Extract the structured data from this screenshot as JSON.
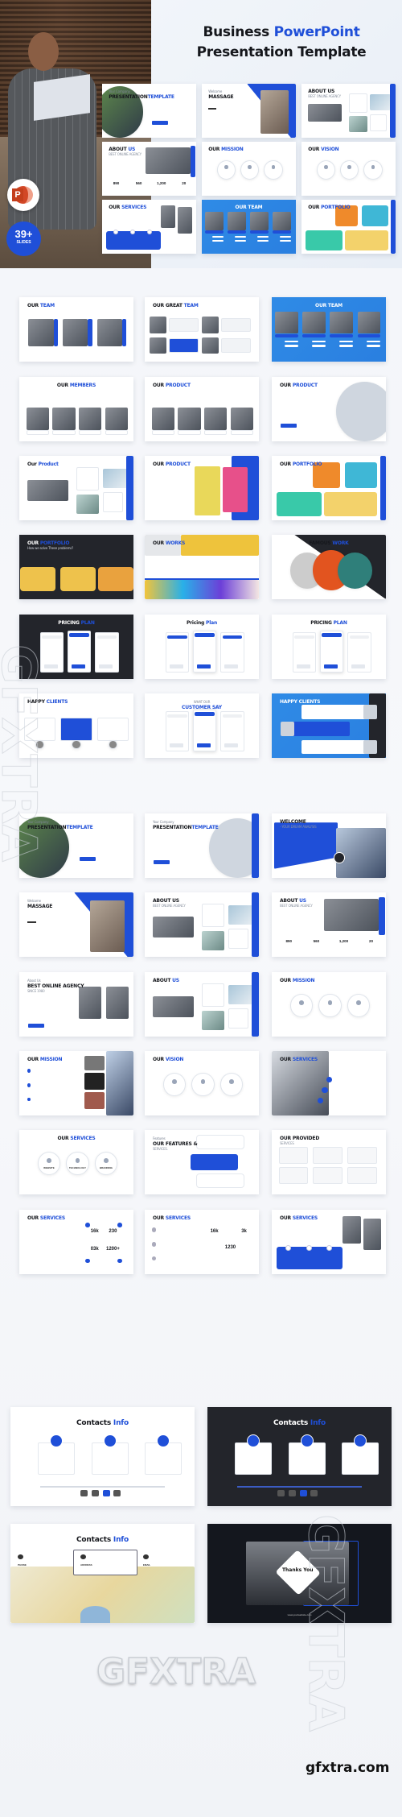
{
  "hero": {
    "title_dark_1": "Business ",
    "title_blue": "PowerPoint",
    "title_line2": "Presentation Template",
    "badge_count": "39+",
    "badge_label": "SLIDES",
    "powerpoint_icon": "powerpoint-logo-icon",
    "powerpoint_letter": "P"
  },
  "colors": {
    "accent": "#1f4fd8",
    "dark": "#23252b",
    "sky": "#2f8be6"
  },
  "hero_slides": [
    {
      "pre": "Your Company",
      "t1": "PRESENTATION",
      "t2": "TEMPLATE",
      "theme": "light",
      "deco": "circle-photo-left"
    },
    {
      "pre": "Welcome",
      "t1": "MASSAGE",
      "t2": "",
      "theme": "light",
      "deco": "photo-right"
    },
    {
      "t1": "ABOUT US",
      "t2": "",
      "sub": "BEST ONLINE AGENCY",
      "theme": "light",
      "deco": "collage"
    },
    {
      "t1": "ABOUT ",
      "t2": "US",
      "sub": "BEST ONLINE AGENCY",
      "theme": "light",
      "deco": "stats-photo",
      "stats": [
        "890",
        "560",
        "1,200",
        "20"
      ]
    },
    {
      "t1": "OUR ",
      "t2": "MISSION",
      "theme": "light",
      "deco": "circles"
    },
    {
      "t1": "OUR ",
      "t2": "VISION",
      "theme": "light",
      "deco": "circles"
    },
    {
      "t1": "OUR ",
      "t2": "SERVICES",
      "theme": "light",
      "deco": "blue-band"
    },
    {
      "t1": "",
      "t2": "OUR TEAM",
      "theme": "blue",
      "align": "center",
      "deco": "team"
    },
    {
      "t1": "OUR ",
      "t2": "PORTFOLIO",
      "theme": "light",
      "deco": "portfolio"
    }
  ],
  "section1": [
    {
      "t1": "OUR ",
      "t2": "TEAM",
      "theme": "light",
      "deco": "photos3"
    },
    {
      "t1": "OUR GREAT ",
      "t2": "TEAM",
      "theme": "light",
      "deco": "grid4"
    },
    {
      "t1": "",
      "t2": "OUR TEAM",
      "theme": "blue",
      "align": "center",
      "deco": "team"
    },
    {
      "t1": "OUR ",
      "t2": "MEMBERS",
      "theme": "light",
      "align": "center",
      "deco": "photos4"
    },
    {
      "t1": "OUR ",
      "t2": "PRODUCT",
      "theme": "light",
      "deco": "photos4"
    },
    {
      "t1": "OUR ",
      "t2": "PRODUCT",
      "theme": "light",
      "deco": "circle-right"
    },
    {
      "t1": "Our ",
      "t2": "Product",
      "theme": "light",
      "deco": "collage"
    },
    {
      "t1": "OUR ",
      "t2": "PRODUCT",
      "theme": "light",
      "deco": "color-panels"
    },
    {
      "t1": "OUR ",
      "t2": "PORTFOLIO",
      "theme": "light",
      "deco": "portfolio"
    },
    {
      "t1": "OUR ",
      "t2": "PORTFOLIO",
      "sub": "How we solve These problems?",
      "theme": "dark",
      "deco": "yellow-row"
    },
    {
      "t1": "OUR ",
      "t2": "WORKS",
      "theme": "light",
      "deco": "works"
    },
    {
      "t1": "FAMOUS ",
      "t2": "WORK",
      "theme": "light",
      "align": "center",
      "deco": "famous"
    },
    {
      "t1": "PRICING ",
      "t2": "PLAN",
      "theme": "dark",
      "align": "center",
      "deco": "pricing"
    },
    {
      "t1": "Pricing ",
      "t2": "Plan",
      "theme": "light",
      "align": "center",
      "deco": "pricing"
    },
    {
      "t1": "PRICING ",
      "t2": "PLAN",
      "theme": "light",
      "align": "center",
      "deco": "pricing"
    },
    {
      "t1": "HAPPY ",
      "t2": "CLIENTS",
      "theme": "light",
      "deco": "clients"
    },
    {
      "pre": "WHAT OUR",
      "t1": "",
      "t2": "CUSTOMER SAY",
      "theme": "light",
      "align": "center",
      "deco": "pricing"
    },
    {
      "t1": "",
      "t2": "HAPPY CLIENTS",
      "theme": "blue",
      "deco": "clients-blue"
    }
  ],
  "section2": [
    {
      "pre": "Your Company",
      "t1": "PRESENTATION",
      "t2": "TEMPLATE",
      "theme": "light",
      "deco": "circle-photo-left"
    },
    {
      "pre": "Your Company",
      "t1": "PRESENTATION",
      "t2": "TEMPLATE",
      "theme": "light",
      "deco": "circle-right"
    },
    {
      "t1": "WELCOME",
      "t2": "",
      "sub": "- YOUR DREAM ANALYSIS",
      "theme": "light",
      "deco": "welcome"
    },
    {
      "pre": "Welcome",
      "t1": "MASSAGE",
      "t2": "",
      "theme": "light",
      "deco": "photo-right"
    },
    {
      "t1": "ABOUT US",
      "t2": "",
      "sub": "BEST ONLINE AGENCY",
      "theme": "light",
      "deco": "collage"
    },
    {
      "t1": "ABOUT ",
      "t2": "US",
      "sub": "BEST ONLINE AGENCY",
      "theme": "light",
      "deco": "stats-photo",
      "stats": [
        "890",
        "560",
        "1,200",
        "20"
      ]
    },
    {
      "pre": "About Us",
      "t1": "BEST ONLINE AGENCY",
      "t2": "",
      "sub": "SINCE 1980",
      "theme": "light",
      "deco": "photos2"
    },
    {
      "t1": "ABOUT ",
      "t2": "US",
      "theme": "light",
      "deco": "collage"
    },
    {
      "t1": "OUR ",
      "t2": "MISSION",
      "theme": "light",
      "deco": "circles"
    },
    {
      "t1": "OUR ",
      "t2": "MISSION",
      "theme": "light",
      "deco": "building"
    },
    {
      "t1": "OUR ",
      "t2": "VISION",
      "theme": "light",
      "deco": "circles"
    },
    {
      "t1": "OUR ",
      "t2": "SERVICES",
      "theme": "light",
      "deco": "photo-left"
    },
    {
      "t1": "OUR ",
      "t2": "SERVICES",
      "theme": "light",
      "align": "center",
      "deco": "circles",
      "labels": [
        "WEBSITE",
        "TECHNOLOGY",
        "BRANDING"
      ]
    },
    {
      "pre": "Features",
      "t1": "OUR FEATURES &",
      "t2": "",
      "sub": "SERVICES.",
      "theme": "light",
      "deco": "features"
    },
    {
      "t1": "OUR PROVIDED",
      "t2": "",
      "sub": "SERVICES",
      "theme": "light",
      "deco": "grid6"
    },
    {
      "t1": "OUR ",
      "t2": "SERVICES",
      "theme": "light",
      "deco": "stats-quad",
      "stats": [
        "16k",
        "230",
        "03k",
        "1200+"
      ]
    },
    {
      "t1": "OUR ",
      "t2": "SERVICES",
      "theme": "light",
      "deco": "stats-tri",
      "stats": [
        "16k",
        "3k",
        "1230"
      ]
    },
    {
      "t1": "OUR ",
      "t2": "SERVICES",
      "theme": "light",
      "deco": "blue-band"
    }
  ],
  "contacts": [
    {
      "t1": "Contacts ",
      "t2": "Info",
      "theme": "light",
      "align": "center",
      "deco": "contact-cards"
    },
    {
      "t1": "Contacts ",
      "t2": "Info",
      "theme": "dark",
      "align": "center",
      "deco": "contact-cards"
    },
    {
      "t1": "Contacts ",
      "t2": "Info",
      "theme": "light",
      "align": "center",
      "deco": "contact-map",
      "labels": [
        "PHONE",
        "ADDRESS",
        "EMAIL"
      ]
    },
    {
      "t1": "",
      "t2": "",
      "theme": "dark",
      "deco": "thanks",
      "thanks": "Thanks You",
      "website": "www.yourwebsite.com"
    }
  ],
  "watermark": {
    "text": "GFXTRA",
    "site": "gfxtra.com"
  }
}
